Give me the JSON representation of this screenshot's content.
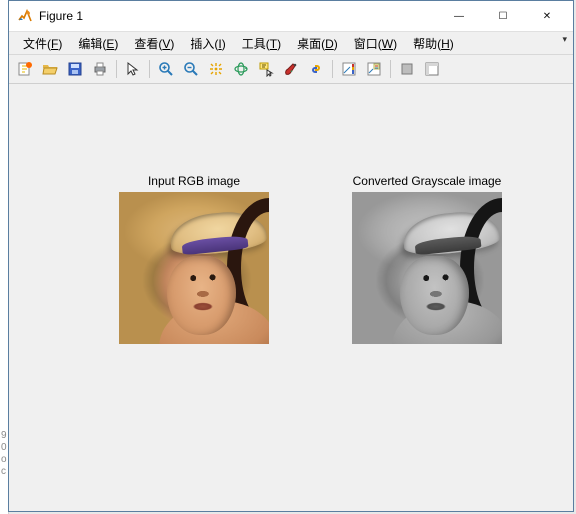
{
  "window": {
    "title": "Figure 1",
    "controls": {
      "minimize": "—",
      "maximize": "☐",
      "close": "✕"
    }
  },
  "menu": {
    "items": [
      {
        "label": "文件",
        "accel": "F"
      },
      {
        "label": "编辑",
        "accel": "E"
      },
      {
        "label": "查看",
        "accel": "V"
      },
      {
        "label": "插入",
        "accel": "I"
      },
      {
        "label": "工具",
        "accel": "T"
      },
      {
        "label": "桌面",
        "accel": "D"
      },
      {
        "label": "窗口",
        "accel": "W"
      },
      {
        "label": "帮助",
        "accel": "H"
      }
    ],
    "overflow": "▾"
  },
  "toolbar": {
    "icons": [
      "new-figure-icon",
      "open-icon",
      "save-icon",
      "print-icon",
      "sep",
      "pointer-icon",
      "sep",
      "zoom-in-icon",
      "zoom-out-icon",
      "pan-icon",
      "rotate3d-icon",
      "datacursor-icon",
      "brush-icon",
      "link-icon",
      "sep",
      "colorbar-icon",
      "legend-icon",
      "sep",
      "hide-plot-tools-icon",
      "show-plot-tools-icon"
    ]
  },
  "subplots": {
    "sp1": {
      "title": "Input RGB image"
    },
    "sp2": {
      "title": "Converted Grayscale image"
    }
  }
}
